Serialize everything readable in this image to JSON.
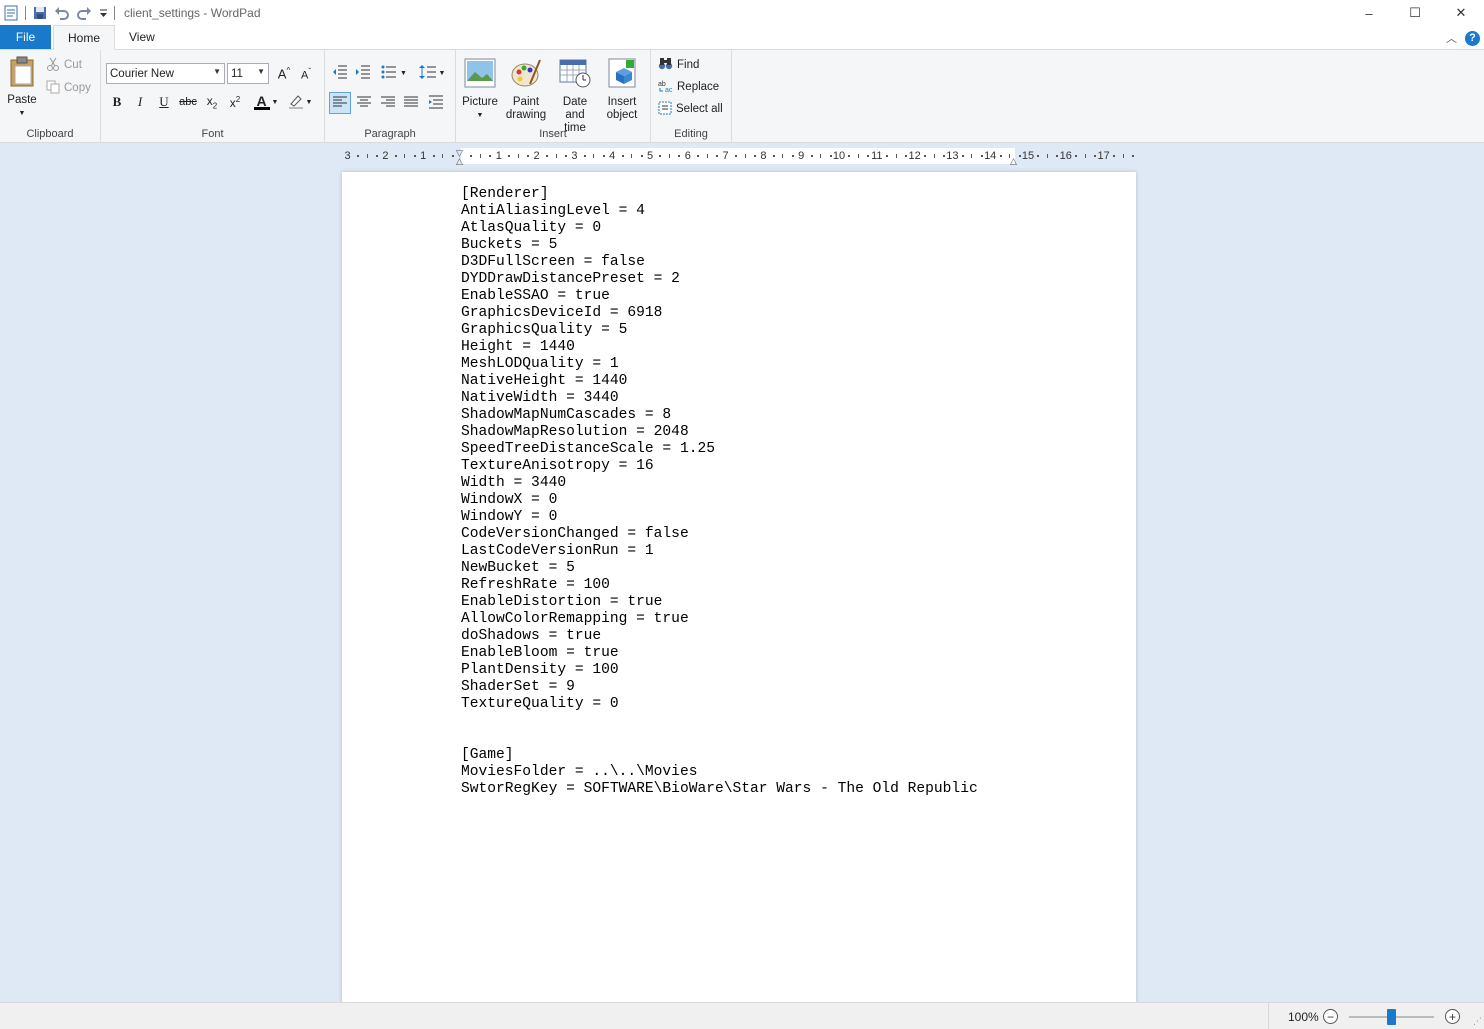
{
  "window": {
    "title": "client_settings - WordPad",
    "controls": {
      "minimize": "–",
      "maximize": "☐",
      "close": "✕"
    }
  },
  "quick_access": {
    "icons": [
      "wordpad-icon",
      "save-icon",
      "undo-icon",
      "redo-icon",
      "customize-icon"
    ]
  },
  "tabs": [
    {
      "label": "File"
    },
    {
      "label": "Home",
      "active": true
    },
    {
      "label": "View"
    }
  ],
  "ribbon": {
    "clipboard": {
      "label": "Clipboard",
      "paste": "Paste",
      "cut": "Cut",
      "copy": "Copy"
    },
    "font": {
      "label": "Font",
      "family": "Courier New",
      "size": "11"
    },
    "paragraph": {
      "label": "Paragraph"
    },
    "insert": {
      "label": "Insert",
      "picture": "Picture",
      "paint_line1": "Paint",
      "paint_line2": "drawing",
      "date_line1": "Date and",
      "date_line2": "time",
      "object_line1": "Insert",
      "object_line2": "object"
    },
    "editing": {
      "label": "Editing",
      "find": "Find",
      "replace": "Replace",
      "select_all": "Select all"
    }
  },
  "ruler": {
    "numbers": [
      "3",
      "2",
      "1",
      "1",
      "2",
      "3",
      "4",
      "5",
      "6",
      "7",
      "8",
      "9",
      "10",
      "11",
      "12",
      "13",
      "14",
      "15",
      "16",
      "17"
    ]
  },
  "document": {
    "lines": [
      "[Renderer]",
      "AntiAliasingLevel = 4",
      "AtlasQuality = 0",
      "Buckets = 5",
      "D3DFullScreen = false",
      "DYDDrawDistancePreset = 2",
      "EnableSSAO = true",
      "GraphicsDeviceId = 6918",
      "GraphicsQuality = 5",
      "Height = 1440",
      "MeshLODQuality = 1",
      "NativeHeight = 1440",
      "NativeWidth = 3440",
      "ShadowMapNumCascades = 8",
      "ShadowMapResolution = 2048",
      "SpeedTreeDistanceScale = 1.25",
      "TextureAnisotropy = 16",
      "Width = 3440",
      "WindowX = 0",
      "WindowY = 0",
      "CodeVersionChanged = false",
      "LastCodeVersionRun = 1",
      "NewBucket = 5",
      "RefreshRate = 100",
      "EnableDistortion = true",
      "AllowColorRemapping = true",
      "doShadows = true",
      "EnableBloom = true",
      "PlantDensity = 100",
      "ShaderSet = 9",
      "TextureQuality = 0",
      "",
      "",
      "[Game]",
      "MoviesFolder = ..\\..\\Movies",
      "SwtorRegKey = SOFTWARE\\BioWare\\Star Wars - The Old Republic"
    ]
  },
  "status": {
    "zoom": "100%",
    "zoom_percent": 100
  },
  "colors": {
    "accent": "#1979ca",
    "workarea": "#dfe9f5",
    "ribbon": "#f5f6f7"
  }
}
